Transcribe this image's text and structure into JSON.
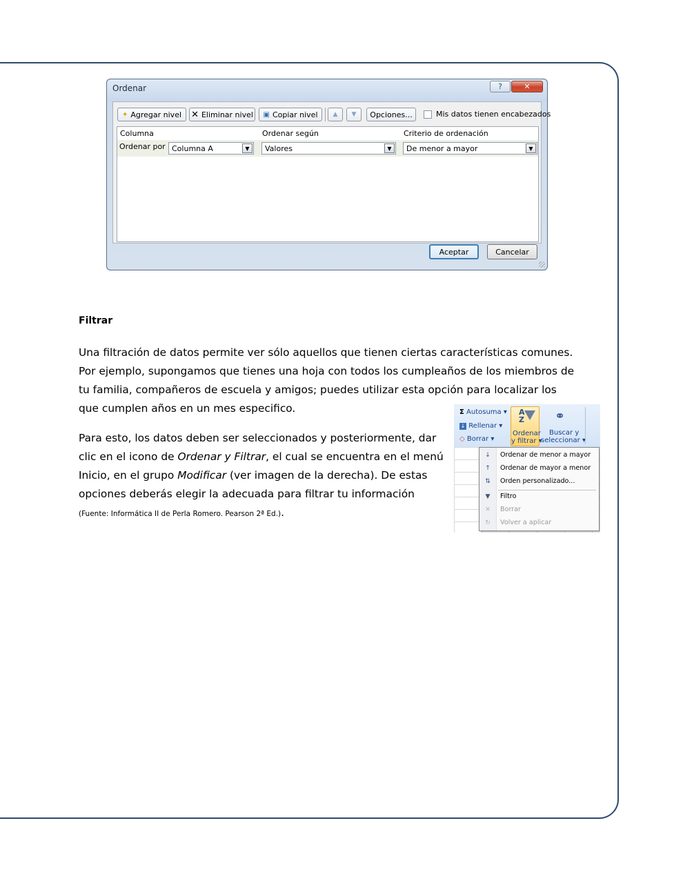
{
  "dialog": {
    "title": "Ordenar",
    "help": "?",
    "close": "✕",
    "toolbar": {
      "add_level": "Agregar nivel",
      "delete_level": "Eliminar nivel",
      "copy_level": "Copiar nivel",
      "options": "Opciones...",
      "headers_checkbox": "Mis datos tienen encabezados"
    },
    "columns": [
      "Columna",
      "Ordenar según",
      "Criterio de ordenación"
    ],
    "row": {
      "label": "Ordenar por",
      "column": "Columna A",
      "sort_on": "Valores",
      "order": "De menor a mayor"
    },
    "ok": "Aceptar",
    "cancel": "Cancelar"
  },
  "section": {
    "heading": "Filtrar",
    "p1": "Una filtración de datos permite ver sólo aquellos que tienen ciertas características comunes. Por ejemplo, supongamos que tienes una hoja con todos los cumpleaños de los miembros de tu familia, compañeros de escuela y amigos; puedes utilizar esta opción para localizar los que cumplen años en un mes especifico.",
    "p2_a": "Para esto, los datos deben ser seleccionados y posteriormente, dar clic en el icono de ",
    "p2_b": "Ordenar y Filtrar",
    "p2_c": ", el cual se encuentra en el menú Inicio, en el grupo ",
    "p2_d": "Modificar",
    "p2_e": " (ver imagen de la derecha). De estas opciones deberás elegir la adecuada para filtrar tu información",
    "source": "(Fuente: Informática II de Perla Romero. Pearson 2ª Ed.)",
    "period": "."
  },
  "ribbon": {
    "autosum": "Autosuma",
    "fill": "Rellenar",
    "clear": "Borrar",
    "sort_filter_1": "Ordenar",
    "sort_filter_2": "y filtrar",
    "find_1": "Buscar y",
    "find_2": "seleccionar",
    "menu": [
      {
        "icon": "A→Z",
        "label": "Ordenar de menor a mayor",
        "enabled": true
      },
      {
        "icon": "Z→A",
        "label": "Ordenar de mayor a menor",
        "enabled": true
      },
      {
        "icon": "⇅",
        "label": "Orden personalizado...",
        "enabled": true
      },
      {
        "icon": "▼",
        "label": "Filtro",
        "enabled": true
      },
      {
        "icon": "✕",
        "label": "Borrar",
        "enabled": false
      },
      {
        "icon": "↻",
        "label": "Volver a aplicar",
        "enabled": false
      }
    ]
  }
}
